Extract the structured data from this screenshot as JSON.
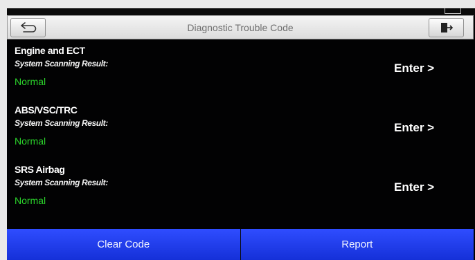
{
  "header": {
    "title": "Diagnostic Trouble Code"
  },
  "icons": {
    "back": "back-arrow-icon",
    "exit": "exit-door-icon"
  },
  "systems": [
    {
      "name": "Engine and ECT",
      "label": "System Scanning Result:",
      "status": "Normal",
      "enter_label": "Enter >"
    },
    {
      "name": "ABS/VSC/TRC",
      "label": "System Scanning Result:",
      "status": "Normal",
      "enter_label": "Enter >"
    },
    {
      "name": "SRS Airbag",
      "label": "System Scanning Result:",
      "status": "Normal",
      "enter_label": "Enter >"
    }
  ],
  "footer": {
    "clear_label": "Clear Code",
    "report_label": "Report"
  },
  "colors": {
    "background": "#020203",
    "status_normal": "#2bd42b",
    "button_blue": "#1f3cf0",
    "header_bg": "#e6e6e6"
  }
}
